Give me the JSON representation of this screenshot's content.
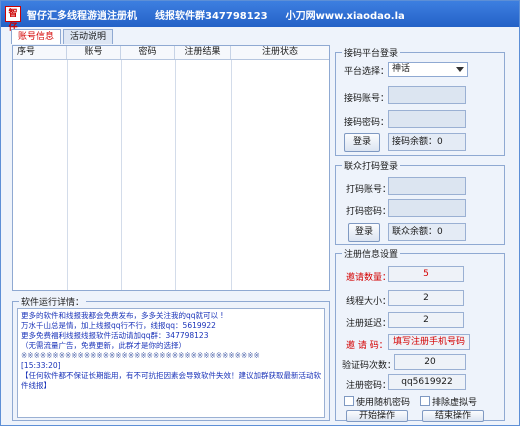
{
  "window": {
    "icon_text": "智仔",
    "title_segments": [
      "智仔汇多线程游逍注册机",
      "线报软件群347798123",
      "小刀网www.xiaodao.la"
    ]
  },
  "tabs": [
    "账号信息",
    "活动说明"
  ],
  "grid": {
    "columns": [
      "序号",
      "账号",
      "密码",
      "注册结果",
      "注册状态"
    ]
  },
  "log": {
    "title": "软件运行详情：",
    "lines": [
      "更多的软件和线报我都会免费发布，多多关注我的qq就可以 !",
      "万水千山总是情，加上线报qq行不行，线报qq：5619922",
      "更多免费福利线报线报软件活动请加qq群：347798123",
      "（无需流量广告，免费更新，此群才是你的选择）",
      "※※※※※※※※※※※※※※※※※※※※※※※※※※※※※※※※※※※※※※",
      "[15:33:20]",
      "【任何软件都不保证长期能用，有不可抗拒因素会导致软件失效！建议加群获取最新活动软件线报】"
    ]
  },
  "platform_login": {
    "title": "接码平台登录",
    "platform_label": "平台选择：",
    "platform_value": "神话",
    "account_label": "接码账号：",
    "password_label": "接码密码：",
    "login_button": "登录",
    "balance_label": "接码余额：0"
  },
  "captcha_login": {
    "title": "联众打码登录",
    "account_label": "打码账号：",
    "password_label": "打码密码：",
    "login_button": "登录",
    "balance_label": "联众余额：0"
  },
  "register_settings": {
    "title": "注册信息设置",
    "invite_count_label": "邀请数量：",
    "invite_count_value": "5",
    "threads_label": "线程大小：",
    "threads_value": "2",
    "delay_label": "注册延迟：",
    "delay_value": "2",
    "invite_code_label": "邀 请 码：",
    "invite_code_value": "填写注册手机号码",
    "captcha_retries_label": "验证码次数：",
    "captcha_retries_value": "20",
    "reg_password_label": "注册密码：",
    "reg_password_value": "qq5619922",
    "random_password_label": "使用随机密码",
    "exclude_virtual_label": "排除虚拟号",
    "start_button": "开始操作",
    "stop_button": "结束操作"
  }
}
